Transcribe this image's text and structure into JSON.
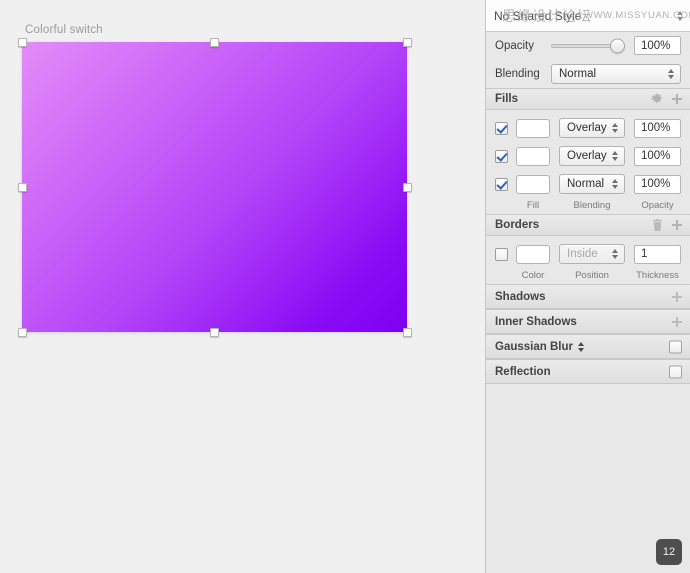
{
  "canvas": {
    "artboard_label": "Colorful switch",
    "shape": {
      "gradient_from": "#e38cf7",
      "gradient_to": "#7d00f2"
    }
  },
  "inspector": {
    "shared_style": {
      "label": "No Shared Style"
    },
    "watermark": {
      "cn": "思缘设计论坛",
      "en": "WWW.MISSYUAN.COM"
    },
    "opacity": {
      "label": "Opacity",
      "value": "100%",
      "slider_percent": 100
    },
    "blending": {
      "label": "Blending",
      "value": "Normal"
    },
    "fills": {
      "title": "Fills",
      "gear_icon": "gear-icon",
      "add_icon": "plus-icon",
      "captions": {
        "fill": "Fill",
        "blending": "Blending",
        "opacity": "Opacity"
      },
      "rows": [
        {
          "enabled": true,
          "color": "#8f8f8f",
          "swatch_style": "linear-gradient(90deg,#cfcfcf 0%,#9b9b9b 55%,#5e5e5e 100%)",
          "blending": "Overlay",
          "opacity": "100%"
        },
        {
          "enabled": true,
          "color": "#f2f2f2",
          "swatch_style": "linear-gradient(90deg,#f6f6f6 0%,#e4e4e4 45%,#fbfbfb 100%)",
          "blending": "Overlay",
          "opacity": "100%"
        },
        {
          "enabled": true,
          "color": "#a93ef5",
          "swatch_style": "linear-gradient(90deg,#b44bf7 0%,#a335f3 100%)",
          "blending": "Normal",
          "opacity": "100%"
        }
      ]
    },
    "borders": {
      "title": "Borders",
      "delete_icon": "trash-icon",
      "add_icon": "plus-icon",
      "enabled": false,
      "color": "#6f6f6f",
      "swatch_style": "linear-gradient(90deg,#7d7d7d 0%,#676767 100%)",
      "position": "Inside",
      "thickness": "1",
      "captions": {
        "color": "Color",
        "position": "Position",
        "thickness": "Thickness"
      }
    },
    "sections": [
      {
        "title": "Shadows",
        "action": "plus-icon",
        "has_checkbox": false,
        "has_stepper": false
      },
      {
        "title": "Inner Shadows",
        "action": "plus-icon",
        "has_checkbox": false,
        "has_stepper": false
      },
      {
        "title": "Gaussian Blur",
        "action": "checkbox",
        "has_checkbox": true,
        "has_stepper": true
      },
      {
        "title": "Reflection",
        "action": "checkbox",
        "has_checkbox": true,
        "has_stepper": false
      }
    ],
    "badge": "12"
  }
}
